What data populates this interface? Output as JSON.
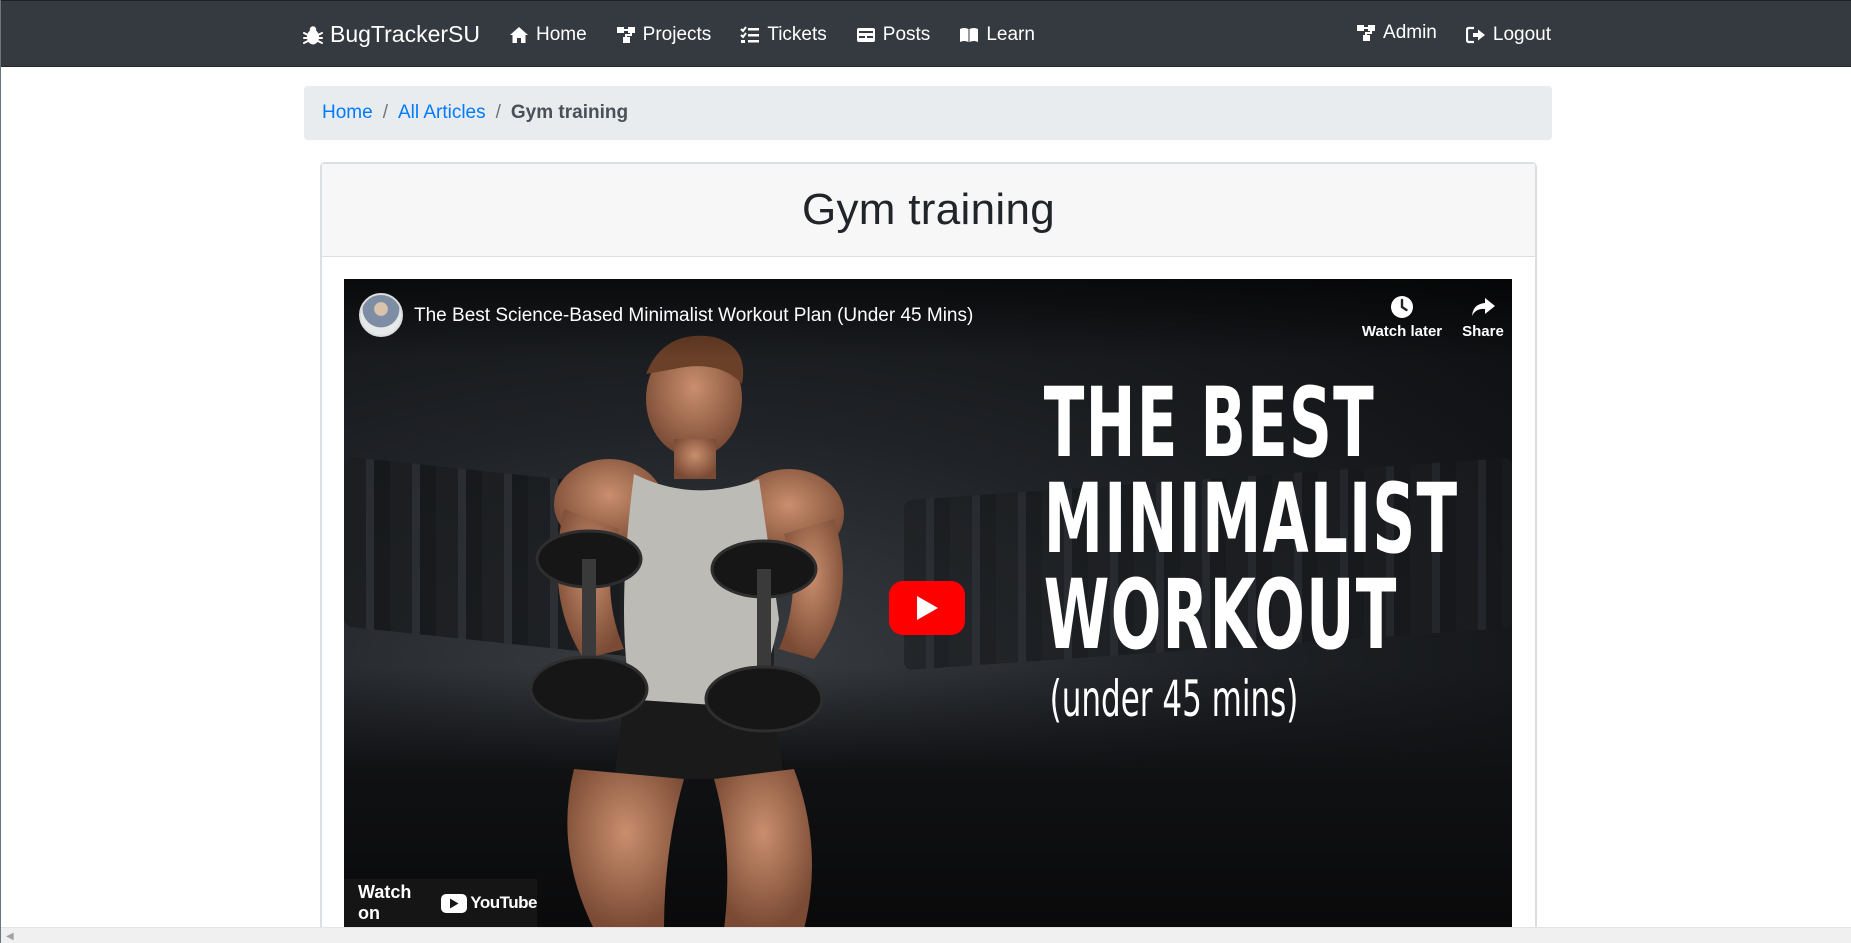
{
  "navbar": {
    "brand": "BugTrackerSU",
    "links": [
      {
        "label": "Home",
        "icon": "home-icon"
      },
      {
        "label": "Projects",
        "icon": "sitemap-icon"
      },
      {
        "label": "Tickets",
        "icon": "list-check-icon"
      },
      {
        "label": "Posts",
        "icon": "card-icon"
      },
      {
        "label": "Learn",
        "icon": "book-icon"
      }
    ],
    "right_links": [
      {
        "label": "Admin",
        "icon": "sitemap-icon"
      },
      {
        "label": "Logout",
        "icon": "sign-out-icon"
      }
    ]
  },
  "breadcrumb": {
    "home": "Home",
    "all_articles": "All Articles",
    "current": "Gym training",
    "separator": "/"
  },
  "article": {
    "title": "Gym training"
  },
  "video": {
    "title": "The Best Science-Based Minimalist Workout Plan (Under 45 Mins)",
    "watch_later": "Watch later",
    "share": "Share",
    "watch_on": "Watch on",
    "youtube": "YouTube",
    "thumbnail_text": [
      "THE BEST",
      "MINIMALIST",
      "WORKOUT"
    ],
    "thumbnail_subtext": "(under 45 mins)"
  },
  "colors": {
    "navbar_bg": "#343a40",
    "link_blue": "#007bff",
    "breadcrumb_bg": "#e9ecef",
    "youtube_red": "#ff0000"
  }
}
